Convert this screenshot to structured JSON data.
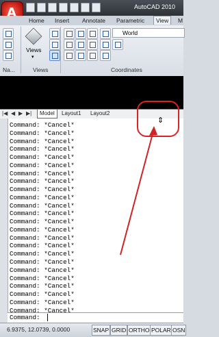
{
  "app": {
    "title": "AutoCAD 2010",
    "logo": "A"
  },
  "quick_access": [
    "new-icon",
    "open-icon",
    "save-icon",
    "undo-icon",
    "redo-icon",
    "print-icon",
    "dropdown-icon"
  ],
  "ribbon_tabs": [
    {
      "label": "Home"
    },
    {
      "label": "Insert"
    },
    {
      "label": "Annotate"
    },
    {
      "label": "Parametric"
    },
    {
      "label": "View"
    },
    {
      "label": "M"
    }
  ],
  "ribbon": {
    "panel_nav": "Na...",
    "views_label": "Views",
    "views_panel": "Views",
    "coords_panel": "Coordinates",
    "ucs_combo": "World"
  },
  "layout_tabs": {
    "model": "Model",
    "layout1": "Layout1",
    "layout2": "Layout2"
  },
  "command_history": [
    "Command: *Cancel*",
    "Command: *Cancel*",
    "Command: *Cancel*",
    "Command: *Cancel*",
    "Command: *Cancel*",
    "Command: *Cancel*",
    "Command: *Cancel*",
    "Command: *Cancel*",
    "Command: *Cancel*",
    "Command: *Cancel*",
    "Command: *Cancel*",
    "Command: *Cancel*",
    "Command: *Cancel*",
    "Command: *Cancel*",
    "Command: *Cancel*",
    "Command: *Cancel*",
    "Command: *Cancel*",
    "Command: *Cancel*",
    "Command: *Cancel*",
    "Command: *Cancel*",
    "Command: *Cancel*",
    "Command: *Cancel*",
    "Command: *Cancel*",
    "Command: *Cancel*"
  ],
  "command_prompt": "Command:",
  "status": {
    "coordinates": "6.9375, 12.0739, 0.0000",
    "buttons": [
      "SNAP",
      "GRID",
      "ORTHO",
      "POLAR",
      "OSN"
    ]
  },
  "colors": {
    "annotation": "#d22222"
  }
}
